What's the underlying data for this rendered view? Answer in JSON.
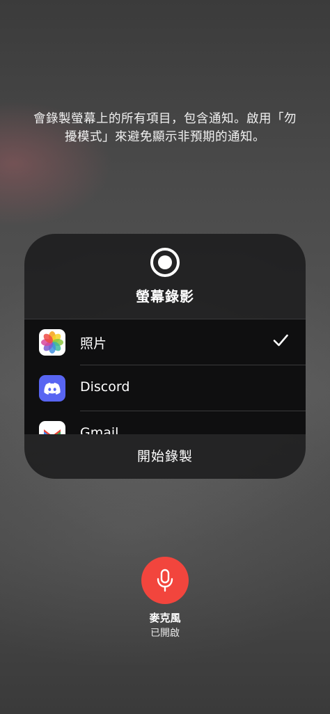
{
  "notice_text": "會錄製螢幕上的所有項目，包含通知。啟用「勿擾模式」來避免顯示非預期的通知。",
  "panel": {
    "title": "螢幕錄影",
    "apps": [
      {
        "label": "照片",
        "icon": "photos-app-icon",
        "selected": true
      },
      {
        "label": "Discord",
        "icon": "discord-app-icon",
        "selected": false
      },
      {
        "label": "Gmail",
        "icon": "gmail-app-icon",
        "selected": false
      }
    ],
    "start_label": "開始錄製"
  },
  "microphone": {
    "title": "麥克風",
    "status": "已開啟",
    "color": "#f2453d"
  },
  "colors": {
    "discord": "#5865f2",
    "panel_bg": "#1c1c1e"
  }
}
